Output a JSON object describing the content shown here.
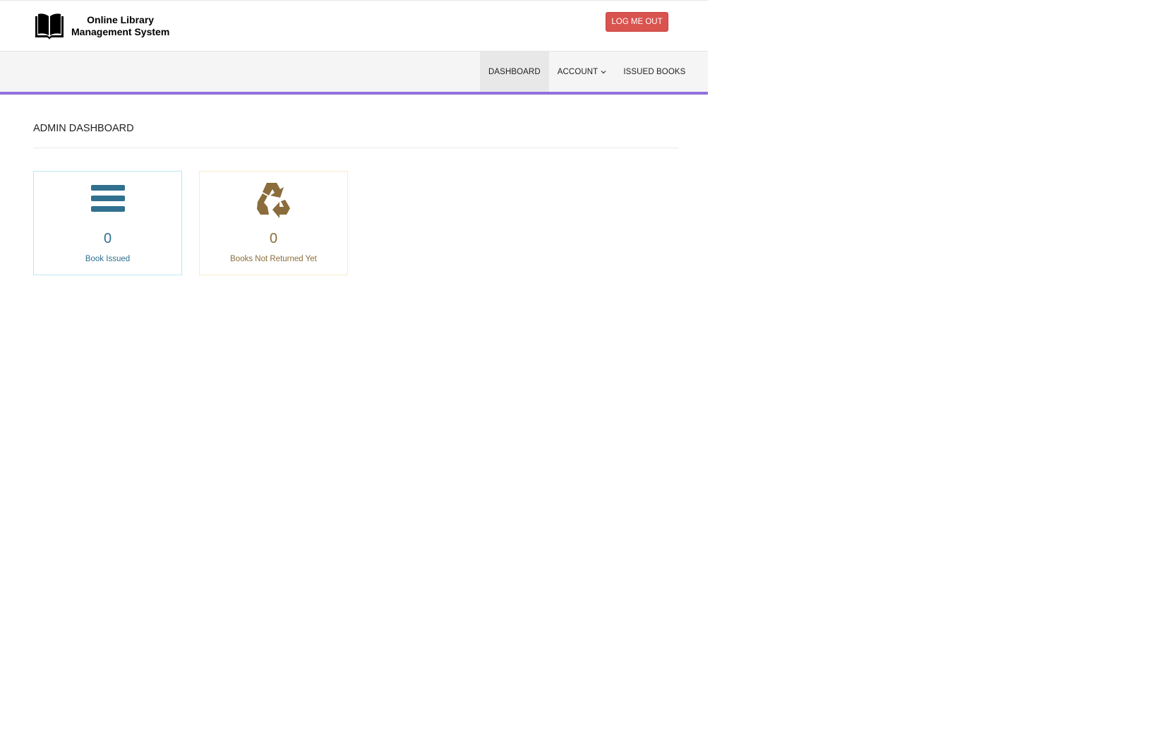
{
  "brand": {
    "line1": "Online Library",
    "line2": "Management System",
    "icon": "open-book-icon"
  },
  "header": {
    "logout_label": "LOG ME OUT",
    "logout_color": "#d9534f"
  },
  "nav": {
    "items": [
      {
        "label": "DASHBOARD",
        "active": true
      },
      {
        "label": "ACCOUNT",
        "dropdown": true
      },
      {
        "label": "ISSUED BOOKS"
      }
    ],
    "accent_color": "#9170e0"
  },
  "main": {
    "title": "ADMIN DASHBOARD",
    "cards": [
      {
        "icon": "bars-icon",
        "count": "0",
        "label": "Book Issued",
        "color": "#31708f",
        "border": "#bce8f1"
      },
      {
        "icon": "recycle-icon",
        "count": "0",
        "label": "Books Not Returned Yet",
        "color": "#8a6d3b",
        "border": "#faebcc"
      }
    ]
  }
}
